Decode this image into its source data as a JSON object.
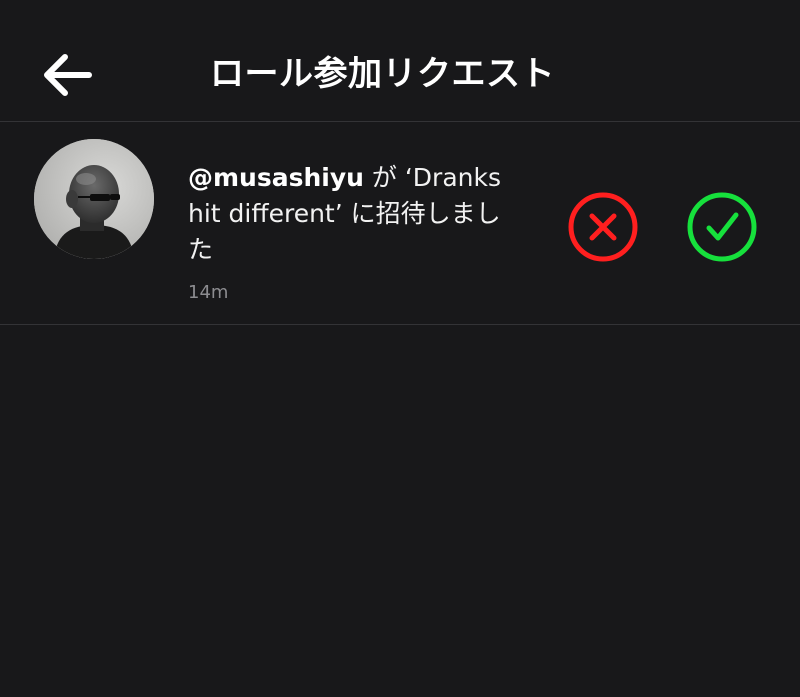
{
  "header": {
    "title": "ロール参加リクエスト",
    "back_icon": "arrow-left-icon"
  },
  "requests": [
    {
      "username": "@musashiyu",
      "message": " が ‘Dranks hit different’ に招待しました",
      "time": "14m",
      "avatar": "user-avatar",
      "decline_icon": "close-circle-icon",
      "accept_icon": "check-circle-icon"
    }
  ],
  "colors": {
    "background": "#18181a",
    "divider": "#333336",
    "decline": "#ff1f1f",
    "accept": "#16e03c",
    "timestamp": "#8c8c90"
  }
}
